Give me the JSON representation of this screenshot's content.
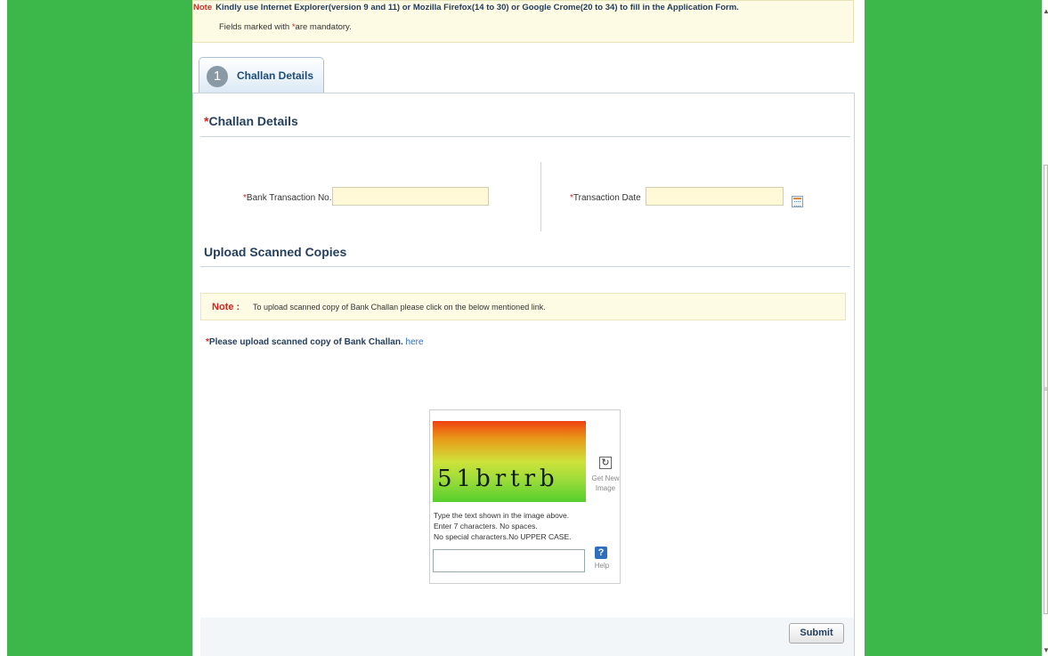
{
  "notice": {
    "note_word": "Note",
    "line1": "Kindly use Internet Explorer(version 9 and 11) or Mozilla Firefox(14 to 30) or Google Crome(20 to 34) to fill in the Application Form.",
    "line2_prefix": "Fields marked with",
    "asterisk": "*",
    "line2_suffix": "are mandatory."
  },
  "tab": {
    "number": "1",
    "label": "Challan Details"
  },
  "challan": {
    "section_title": "Challan Details",
    "bank_txn_label": "Bank Transaction No.",
    "bank_txn_value": "",
    "txn_date_label": "Transaction Date",
    "txn_date_value": ""
  },
  "upload": {
    "section_title": "Upload Scanned Copies",
    "note_label": "Note :",
    "note_text": "To upload scanned copy of Bank Challan please click on the below mentioned link.",
    "prompt": "Please upload scanned copy of Bank Challan.",
    "link": "here"
  },
  "captcha": {
    "image_text": "51brtrb",
    "refresh_label": "Get New Image",
    "instr1": "Type the text shown in the image above.",
    "instr2": "Enter 7 characters. No spaces.",
    "instr3": "No special characters.No UPPER CASE.",
    "input_value": "",
    "help_symbol": "?",
    "help_label": "Help"
  },
  "submit_label": "Submit",
  "scrollbar": {
    "up_arrow": "▲",
    "down_arrow": "▼",
    "grip": "≡"
  },
  "colors": {
    "background_green": "#3cb84b",
    "required_red": "#d9221c",
    "heading_blue": "#253f5e"
  }
}
